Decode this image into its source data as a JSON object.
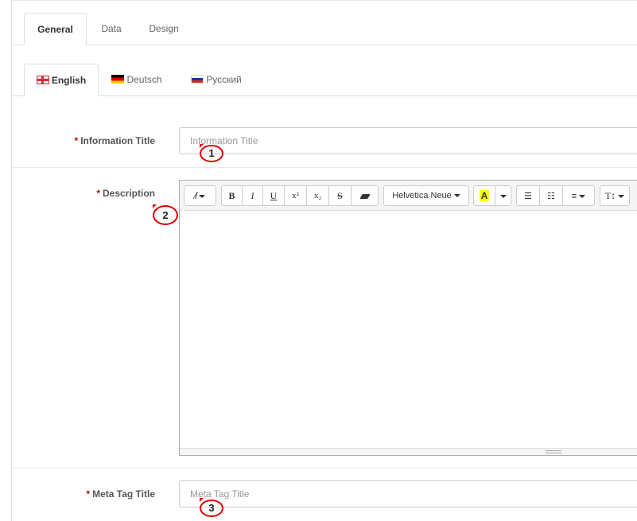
{
  "main_tabs": [
    "General",
    "Data",
    "Design"
  ],
  "lang_tabs": [
    "English",
    "Deutsch",
    "Русский"
  ],
  "fields": {
    "info_title": {
      "label": "Information Title",
      "placeholder": "Information Title",
      "marker": "1"
    },
    "description": {
      "label": "Description",
      "marker": "2"
    },
    "meta_title": {
      "label": "Meta Tag Title",
      "placeholder": "Meta Tag Title",
      "marker": "3"
    }
  },
  "toolbar": {
    "bold": "B",
    "italic": "I",
    "underline": "U",
    "superscript": "x²",
    "subscript": "x₂",
    "strikethrough": "S",
    "font": "Helvetica Neue",
    "color": "A",
    "fontsize": "T↕"
  },
  "colors": {
    "required": "#cc0000",
    "highlight": "#ffff00",
    "marker": "#dd0000"
  }
}
